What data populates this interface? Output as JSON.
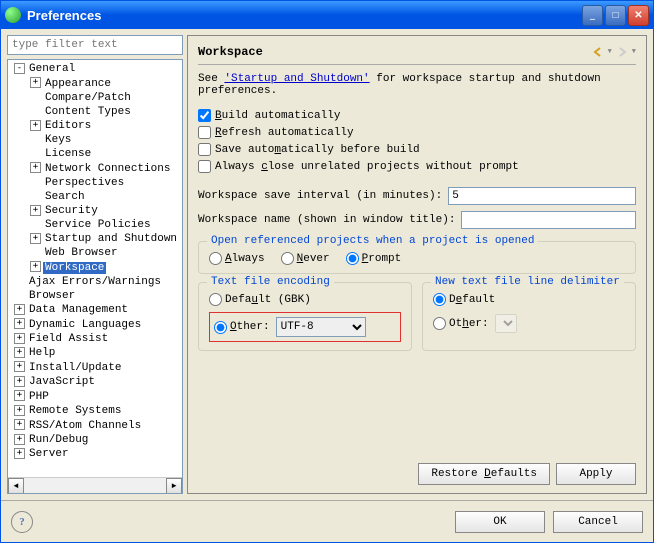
{
  "window": {
    "title": "Preferences"
  },
  "filter": {
    "placeholder": "type filter text"
  },
  "tree": {
    "items": [
      {
        "label": "General",
        "level": 1,
        "exp": "-"
      },
      {
        "label": "Appearance",
        "level": 2,
        "exp": "+"
      },
      {
        "label": "Compare/Patch",
        "level": 2,
        "exp": ""
      },
      {
        "label": "Content Types",
        "level": 2,
        "exp": ""
      },
      {
        "label": "Editors",
        "level": 2,
        "exp": "+"
      },
      {
        "label": "Keys",
        "level": 2,
        "exp": ""
      },
      {
        "label": "License",
        "level": 2,
        "exp": ""
      },
      {
        "label": "Network Connections",
        "level": 2,
        "exp": "+"
      },
      {
        "label": "Perspectives",
        "level": 2,
        "exp": ""
      },
      {
        "label": "Search",
        "level": 2,
        "exp": ""
      },
      {
        "label": "Security",
        "level": 2,
        "exp": "+"
      },
      {
        "label": "Service Policies",
        "level": 2,
        "exp": ""
      },
      {
        "label": "Startup and Shutdown",
        "level": 2,
        "exp": "+"
      },
      {
        "label": "Web Browser",
        "level": 2,
        "exp": ""
      },
      {
        "label": "Workspace",
        "level": 2,
        "exp": "+",
        "selected": true
      },
      {
        "label": "Ajax Errors/Warnings",
        "level": 1,
        "exp": ""
      },
      {
        "label": "Browser",
        "level": 1,
        "exp": ""
      },
      {
        "label": "Data Management",
        "level": 1,
        "exp": "+"
      },
      {
        "label": "Dynamic Languages",
        "level": 1,
        "exp": "+"
      },
      {
        "label": "Field Assist",
        "level": 1,
        "exp": "+"
      },
      {
        "label": "Help",
        "level": 1,
        "exp": "+"
      },
      {
        "label": "Install/Update",
        "level": 1,
        "exp": "+"
      },
      {
        "label": "JavaScript",
        "level": 1,
        "exp": "+"
      },
      {
        "label": "PHP",
        "level": 1,
        "exp": "+"
      },
      {
        "label": "Remote Systems",
        "level": 1,
        "exp": "+"
      },
      {
        "label": "RSS/Atom Channels",
        "level": 1,
        "exp": "+"
      },
      {
        "label": "Run/Debug",
        "level": 1,
        "exp": "+"
      },
      {
        "label": "Server",
        "level": 1,
        "exp": "+"
      }
    ]
  },
  "panel": {
    "title": "Workspace",
    "desc_prefix": "See ",
    "desc_link": "'Startup and Shutdown'",
    "desc_suffix": " for workspace startup and shutdown preferences.",
    "checks": {
      "build": "Build automatically",
      "refresh": "Refresh automatically",
      "save": "Save automatically before build",
      "close": "Always close unrelated projects without prompt"
    },
    "interval": {
      "label": "Workspace save interval (in minutes):",
      "value": "5"
    },
    "wsname": {
      "label": "Workspace name (shown in window title):",
      "value": ""
    },
    "openref": {
      "title": "Open referenced projects when a project is opened",
      "always": "Always",
      "never": "Never",
      "prompt": "Prompt"
    },
    "encoding": {
      "title": "Text file encoding",
      "default": "Default (GBK)",
      "other": "Other:",
      "value": "UTF-8"
    },
    "delimiter": {
      "title": "New text file line delimiter",
      "default": "Default",
      "other": "Other:"
    },
    "buttons": {
      "restore": "Restore Defaults",
      "apply": "Apply"
    }
  },
  "footer": {
    "ok": "OK",
    "cancel": "Cancel"
  }
}
